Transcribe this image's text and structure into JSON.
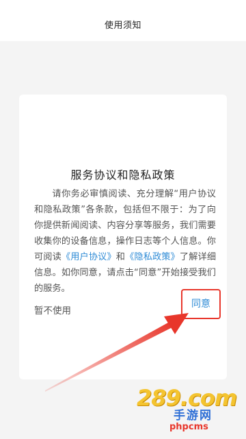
{
  "header": {
    "title": "使用须知"
  },
  "dialog": {
    "title": "服务协议和隐私政策",
    "body_part1": "请你务必审慎阅读、充分理解“用户协议和隐私政策”各条款，包括但不限于：为了向你提供新闻阅读、内容分享等服务，我们需要收集你的设备信息，操作日志等个人信息。你可阅读",
    "user_agreement_link": "《用户协议》",
    "body_and": "和",
    "privacy_policy_link": "《隐私政策》",
    "body_part2": "了解详细信息。如你同意，请点击“同意”开始接受我们的服务。",
    "decline_label": "暂不使用",
    "agree_label": "同意"
  },
  "watermark": {
    "main": "289.com",
    "sub": "手游网",
    "cms": "phpcms"
  },
  "colors": {
    "link": "#2e8bd6",
    "highlight": "#e8362b",
    "background": "#f4f4f4"
  }
}
